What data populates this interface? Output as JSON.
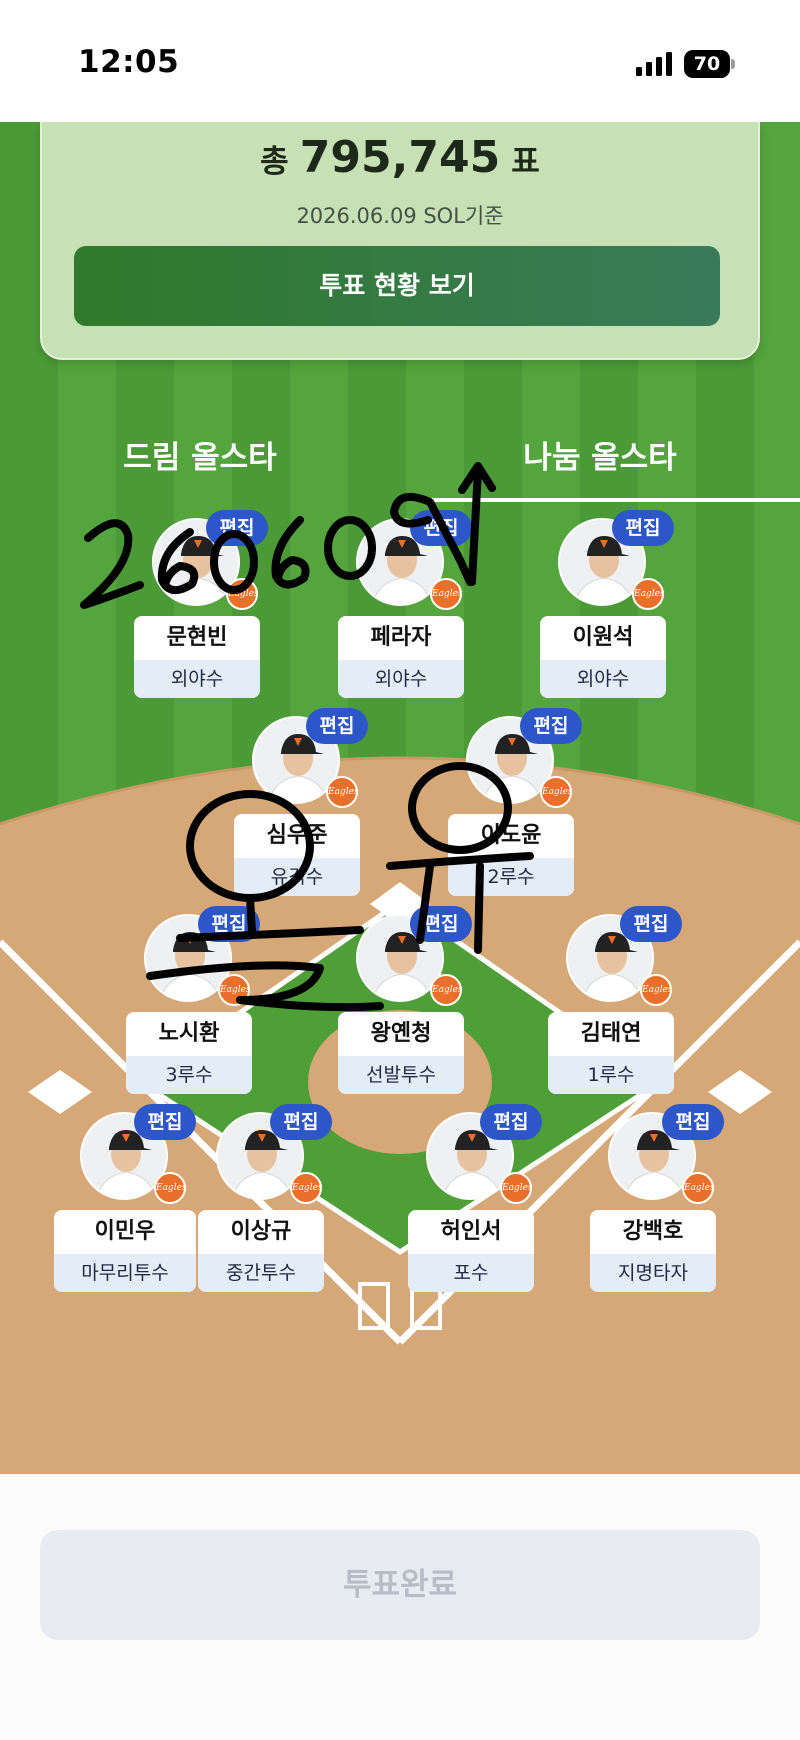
{
  "status_bar": {
    "time": "12:05",
    "battery": "70"
  },
  "summary": {
    "prefix": "총",
    "total_votes": "795,745",
    "unit": "표",
    "date_basis": "2026.06.09 SOL기준",
    "status_button": "투표 현황 보기"
  },
  "tabs": [
    {
      "label": "드림 올스타",
      "selected": false
    },
    {
      "label": "나눔 올스타",
      "selected": true
    }
  ],
  "edit_label": "편집",
  "team_logo": "Eagles",
  "players": [
    {
      "name": "문현빈",
      "position": "외야수"
    },
    {
      "name": "페라자",
      "position": "외야수"
    },
    {
      "name": "이원석",
      "position": "외야수"
    },
    {
      "name": "심우준",
      "position": "유격수"
    },
    {
      "name": "이도윤",
      "position": "2루수"
    },
    {
      "name": "노시환",
      "position": "3루수"
    },
    {
      "name": "왕옌청",
      "position": "선발투수"
    },
    {
      "name": "김태연",
      "position": "1루수"
    },
    {
      "name": "이민우",
      "position": "마무리투수"
    },
    {
      "name": "이상규",
      "position": "중간투수"
    },
    {
      "name": "허인서",
      "position": "포수"
    },
    {
      "name": "강백호",
      "position": "지명타자"
    }
  ],
  "vote_complete_button": "투표완료",
  "colors": {
    "field_green": "#4b9a37",
    "dirt": "#d6a878",
    "card_green": "#c8e0b6",
    "edit_badge_blue": "#2d56c8",
    "logo_orange": "#e8702a"
  }
}
